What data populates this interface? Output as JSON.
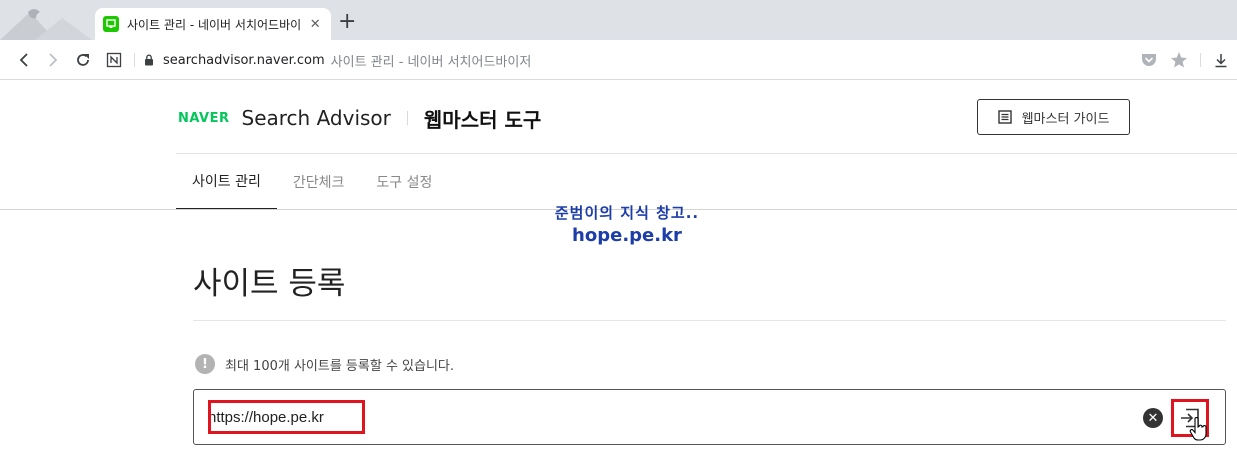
{
  "browser": {
    "tab_title": "사이트 관리 - 네이버 서치어드바이저",
    "close_glyph": "✕",
    "new_tab_glyph": "+",
    "url_host": "searchadvisor.naver.com",
    "url_page_title": "사이트 관리 - 네이버 서치어드바이저"
  },
  "header": {
    "logo": "NAVER",
    "brand_name": "Search Advisor",
    "subtitle": "웹마스터 도구",
    "guide_button": "웹마스터 가이드"
  },
  "nav": {
    "tabs": [
      {
        "label": "사이트 관리",
        "active": true
      },
      {
        "label": "간단체크",
        "active": false
      },
      {
        "label": "도구 설정",
        "active": false
      }
    ]
  },
  "watermark": {
    "line1": "준범이의 지식 창고..",
    "line2": "hope.pe.kr"
  },
  "main": {
    "title": "사이트 등록",
    "notice_icon": "!",
    "notice": "최대 100개 사이트를 등록할 수 있습니다.",
    "url_input_value": "https://hope.pe.kr",
    "clear_glyph": "✕"
  },
  "colors": {
    "naver_green": "#03c75a",
    "highlight_red": "#e0141e",
    "watermark_blue": "#1d3da8"
  }
}
